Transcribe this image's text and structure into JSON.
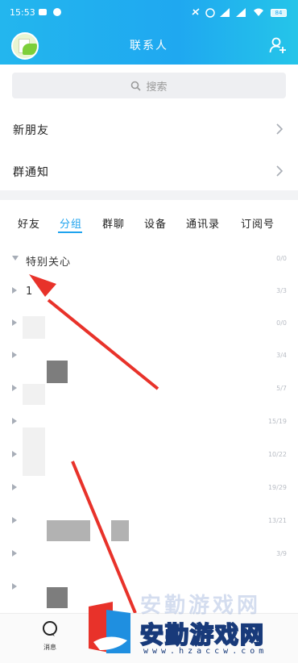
{
  "status_bar": {
    "time": "15:53",
    "battery": "84"
  },
  "header": {
    "title": "联系人"
  },
  "search": {
    "placeholder": "搜索"
  },
  "menu": [
    {
      "label": "新朋友"
    },
    {
      "label": "群通知"
    }
  ],
  "tabs": [
    {
      "label": "好友",
      "active": false
    },
    {
      "label": "分组",
      "active": true
    },
    {
      "label": "群聊",
      "active": false
    },
    {
      "label": "设备",
      "active": false
    },
    {
      "label": "通讯录",
      "active": false
    },
    {
      "label": "订阅号",
      "active": false
    }
  ],
  "groups": [
    {
      "name": "特别关心",
      "count": "0/0",
      "expanded": true
    },
    {
      "name": "1",
      "count": "3/3",
      "expanded": false
    },
    {
      "name": "",
      "count": "0/0",
      "expanded": false
    },
    {
      "name": "",
      "count": "3/4",
      "expanded": false
    },
    {
      "name": "",
      "count": "5/7",
      "expanded": false
    },
    {
      "name": "",
      "count": "15/19",
      "expanded": false
    },
    {
      "name": "",
      "count": "10/22",
      "expanded": false
    },
    {
      "name": "",
      "count": "19/29",
      "expanded": false
    },
    {
      "name": "",
      "count": "13/21",
      "expanded": false
    },
    {
      "name": "",
      "count": "3/9",
      "expanded": false
    },
    {
      "name": "",
      "count": "",
      "expanded": false
    }
  ],
  "bottom_nav": {
    "messages_label": "消息"
  },
  "watermark": {
    "text": "安勤游戏网",
    "url": "www.hzaccw.com"
  },
  "colors": {
    "accent": "#1fa3ee",
    "header": "#23b6ee",
    "arrow": "#e8322a"
  }
}
